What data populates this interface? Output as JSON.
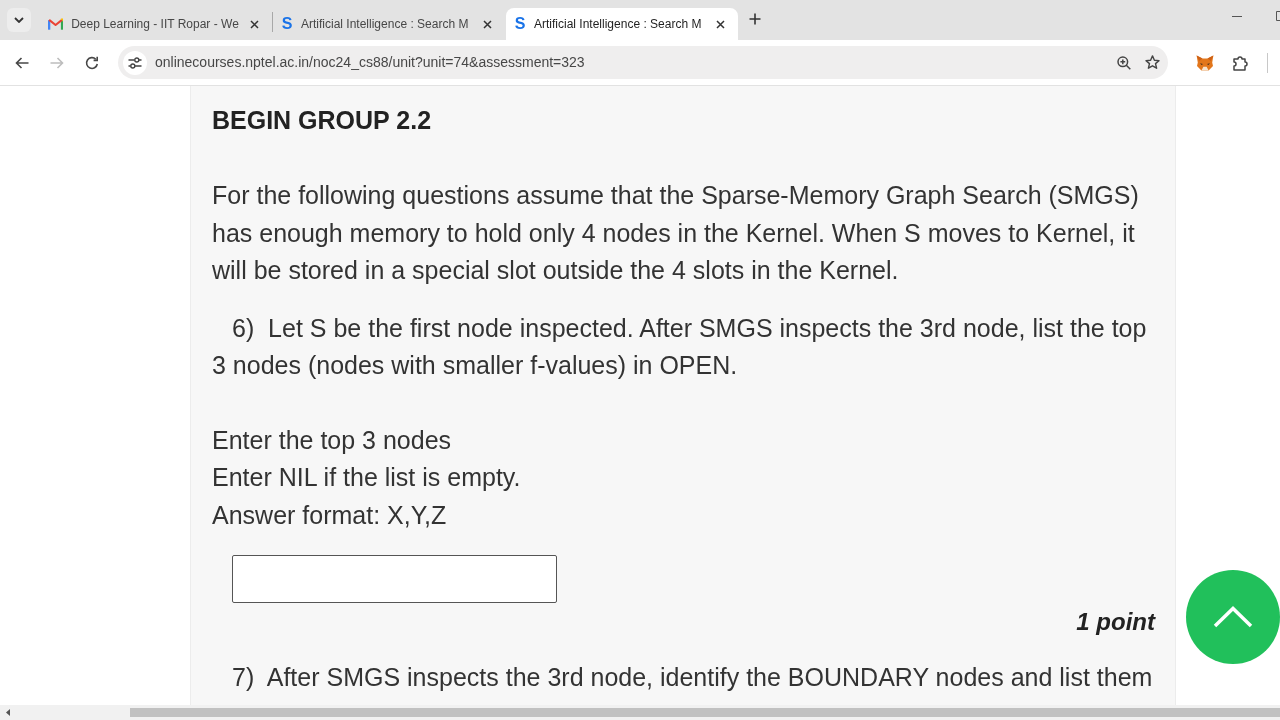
{
  "browser": {
    "tabs": [
      {
        "title": "Deep Learning - IIT Ropar - We",
        "favicon": {
          "kind": "mail"
        },
        "selected": false
      },
      {
        "title": "Artificial Intelligence : Search M",
        "favicon": {
          "kind": "letter",
          "text": "S"
        },
        "selected": false
      },
      {
        "title": "Artificial Intelligence : Search M",
        "favicon": {
          "kind": "letter",
          "text": "S"
        },
        "selected": true
      }
    ],
    "toolbar": {
      "forward_disabled": true,
      "url": "onlinecourses.nptel.ac.in/noc24_cs88/unit?unit=74&assessment=323",
      "bookmarked": false
    }
  },
  "page": {
    "group_title": "BEGIN GROUP 2.2",
    "intro": "For the following questions assume that the Sparse-Memory Graph Search (SMGS) has enough memory to hold only 4 nodes in the Kernel. When S moves to Kernel, it will be stored in a special slot outside the 4 slots in the Kernel.",
    "questions": [
      {
        "text": "6)  Let S be the first node inspected. After SMGS inspects the 3rd node, list the top 3 nodes (nodes with smaller f-values) in OPEN.",
        "instructions": [
          "Enter the top 3 nodes",
          "Enter NIL if the list is empty.",
          "Answer format: X,Y,Z"
        ],
        "answer_box": true
      },
      {
        "points": "1 point",
        "text": "7)  After SMGS inspects the 3rd node, identify the BOUNDARY nodes and list them",
        "answer_box": false
      }
    ]
  }
}
